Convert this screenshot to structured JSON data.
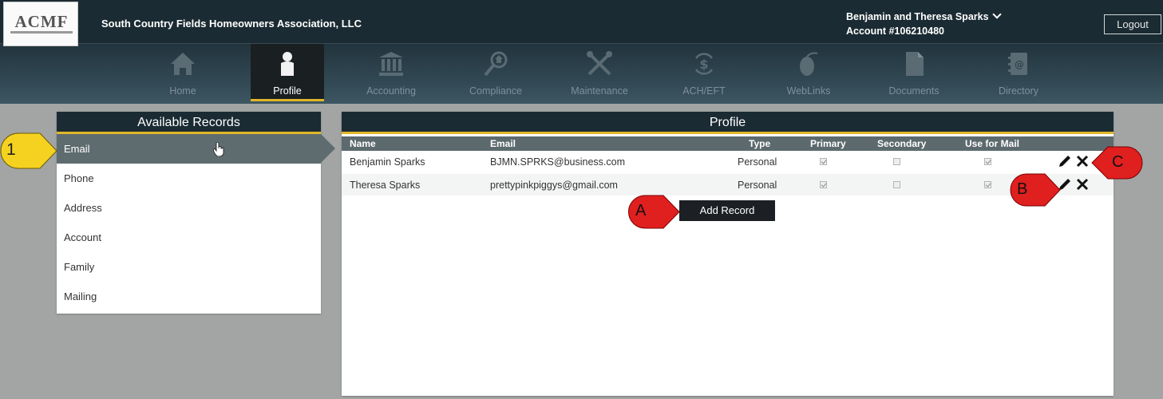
{
  "header": {
    "logo_text": "ACMF",
    "org_name": "South Country Fields Homeowners Association, LLC",
    "user_name": "Benjamin and Theresa Sparks",
    "account": "Account #106210480",
    "logout_label": "Logout"
  },
  "nav": {
    "items": [
      {
        "label": "Home",
        "icon": "house-icon"
      },
      {
        "label": "Profile",
        "icon": "person-icon",
        "active": true
      },
      {
        "label": "Accounting",
        "icon": "bank-icon"
      },
      {
        "label": "Compliance",
        "icon": "magnifier-house-icon"
      },
      {
        "label": "Maintenance",
        "icon": "wrench-screwdriver-icon"
      },
      {
        "label": "ACH/EFT",
        "icon": "dollar-cycle-icon"
      },
      {
        "label": "WebLinks",
        "icon": "mouse-icon"
      },
      {
        "label": "Documents",
        "icon": "document-icon"
      },
      {
        "label": "Directory",
        "icon": "address-book-icon"
      }
    ]
  },
  "records": {
    "title": "Available Records",
    "items": [
      "Email",
      "Phone",
      "Address",
      "Account",
      "Family",
      "Mailing"
    ],
    "selected": "Email"
  },
  "profile": {
    "title": "Profile",
    "columns": [
      "Name",
      "Email",
      "Type",
      "Primary",
      "Secondary",
      "Use for Mail"
    ],
    "rows": [
      {
        "name": "Benjamin Sparks",
        "email": "BJMN.SPRKS@business.com",
        "type": "Personal",
        "primary": true,
        "secondary": false,
        "use_for_mail": true
      },
      {
        "name": "Theresa Sparks",
        "email": "prettypinkpiggys@gmail.com",
        "type": "Personal",
        "primary": true,
        "secondary": false,
        "use_for_mail": true
      }
    ],
    "add_label": "Add Record"
  },
  "callouts": {
    "one": "1",
    "a": "A",
    "b": "B",
    "c": "C",
    "yellow": "#f5d21f",
    "red": "#e01f1f"
  },
  "colors": {
    "header_bg": "#1b2b33",
    "accent": "#e0b62a",
    "selected_row": "#5f6c6f"
  }
}
